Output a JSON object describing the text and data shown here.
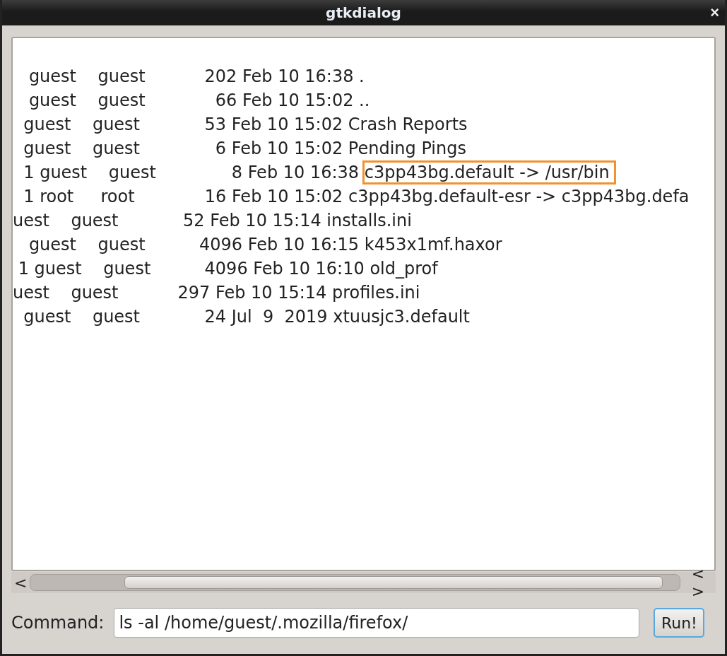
{
  "window": {
    "title": "gtkdialog",
    "close": "×"
  },
  "output": {
    "lines": [
      {
        "text": "   guest    guest           202 Feb 10 16:38 ",
        "name": ".",
        "highlighted": false
      },
      {
        "text": "   guest    guest             66 Feb 10 15:02 ",
        "name": "..",
        "highlighted": false
      },
      {
        "text": "  guest    guest            53 Feb 10 15:02 ",
        "name": "Crash Reports",
        "highlighted": false
      },
      {
        "text": "  guest    guest              6 Feb 10 15:02 ",
        "name": "Pending Pings",
        "highlighted": false
      },
      {
        "text": "  1 guest    guest              8 Feb 10 16:38 ",
        "name": "c3pp43bg.default -> /usr/bin",
        "highlighted": true
      },
      {
        "text": "  1 root     root             16 Feb 10 15:02 ",
        "name": "c3pp43bg.default-esr -> c3pp43bg.defa",
        "highlighted": false
      },
      {
        "text": "uest    guest            52 Feb 10 15:14 ",
        "name": "installs.ini",
        "highlighted": false
      },
      {
        "text": "   guest    guest          4096 Feb 10 16:15 ",
        "name": "k453x1mf.haxor",
        "highlighted": false
      },
      {
        "text": " 1 guest    guest          4096 Feb 10 16:10 ",
        "name": "old_prof",
        "highlighted": false
      },
      {
        "text": "uest    guest           297 Feb 10 15:14 ",
        "name": "profiles.ini",
        "highlighted": false
      },
      {
        "text": "  guest    guest            24 Jul  9  2019 ",
        "name": "xtuusjc3.default",
        "highlighted": false
      }
    ]
  },
  "scrollbar": {
    "left": "<",
    "right_arrows": "< >"
  },
  "command": {
    "label": "Command:",
    "value": "ls -al /home/guest/.mozilla/firefox/",
    "button": "Run!"
  }
}
